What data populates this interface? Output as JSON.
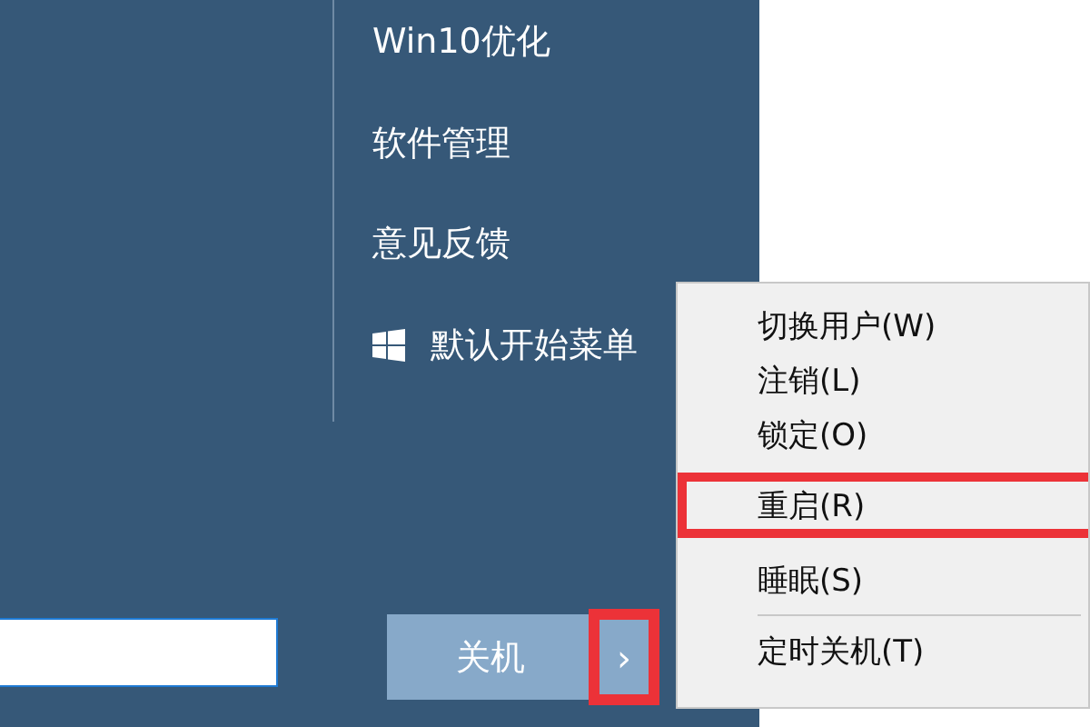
{
  "nav_items": [
    {
      "label": "Win10优化",
      "icon": false
    },
    {
      "label": "软件管理",
      "icon": false
    },
    {
      "label": "意见反馈",
      "icon": false
    },
    {
      "label": "默认开始菜单",
      "icon": true
    }
  ],
  "power": {
    "label": "关机",
    "more": {
      "label": "›",
      "highlighted": true
    }
  },
  "power_menu": {
    "groups": [
      [
        {
          "label": "切换用户(W)",
          "highlighted": false
        },
        {
          "label": "注销(L)",
          "highlighted": false
        },
        {
          "label": "锁定(O)",
          "highlighted": false
        },
        {
          "label": "重启(R)",
          "highlighted": true
        },
        {
          "label": "睡眠(S)",
          "highlighted": false
        }
      ],
      [
        {
          "label": "定时关机(T)",
          "highlighted": false
        }
      ]
    ]
  }
}
